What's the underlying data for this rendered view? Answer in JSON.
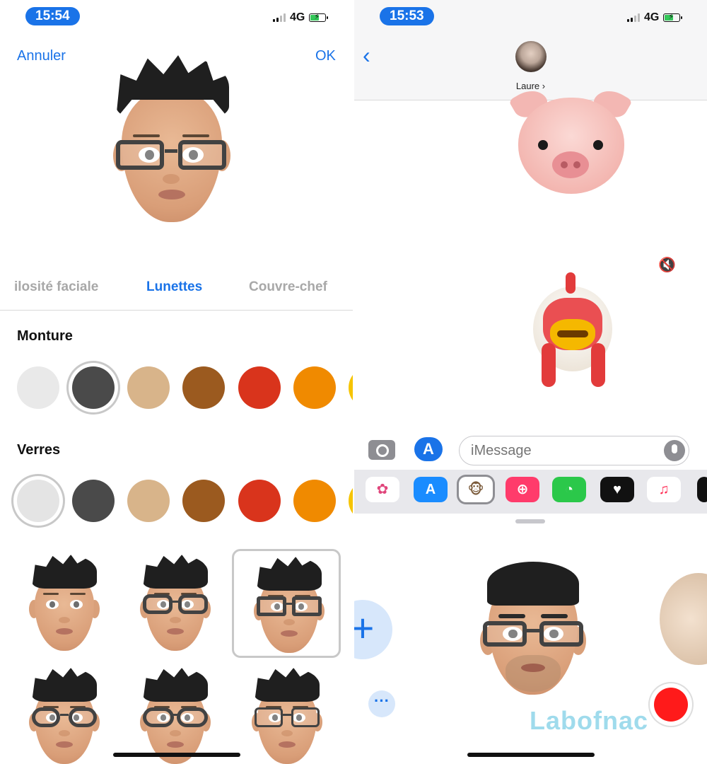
{
  "colors": {
    "accent": "#1a73e8",
    "record": "#ff1a1a"
  },
  "left": {
    "status": {
      "time": "15:54",
      "network": "4G"
    },
    "cancel_label": "Annuler",
    "ok_label": "OK",
    "tabs": [
      {
        "label": "ilosité faciale",
        "active": false
      },
      {
        "label": "Lunettes",
        "active": true
      },
      {
        "label": "Couvre-chef",
        "active": false
      }
    ],
    "frame_section_title": "Monture",
    "lens_section_title": "Verres",
    "frame_colors": [
      "#e9e9e9",
      "#4a4a4a",
      "#d8b48a",
      "#9b5a1f",
      "#d9341c",
      "#f08a00",
      "#f6c400"
    ],
    "frame_selected_index": 1,
    "lens_colors": [
      "#e4e4e4",
      "#4a4a4a",
      "#d8b48a",
      "#9b5a1f",
      "#d9341c",
      "#f08a00",
      "#f6c400"
    ],
    "lens_selected_index": 0,
    "glasses_options_selected_index": 2
  },
  "right": {
    "status": {
      "time": "15:53",
      "network": "4G"
    },
    "contact_name": "Laure ›",
    "message_placeholder": "iMessage",
    "watermark": "Labofnac",
    "apps": [
      {
        "icon": "photos-icon",
        "color": "#ffffff"
      },
      {
        "icon": "app-store-icon",
        "color": "#1a8cff"
      },
      {
        "icon": "animoji-monkey-icon",
        "color": "#ffffff",
        "selected": true
      },
      {
        "icon": "search-web-icon",
        "color": "#ff3b6b"
      },
      {
        "icon": "clock-icon",
        "color": "#2bc84a"
      },
      {
        "icon": "digital-touch-icon",
        "color": "#111111"
      },
      {
        "icon": "music-icon",
        "color": "#ffffff"
      }
    ]
  }
}
